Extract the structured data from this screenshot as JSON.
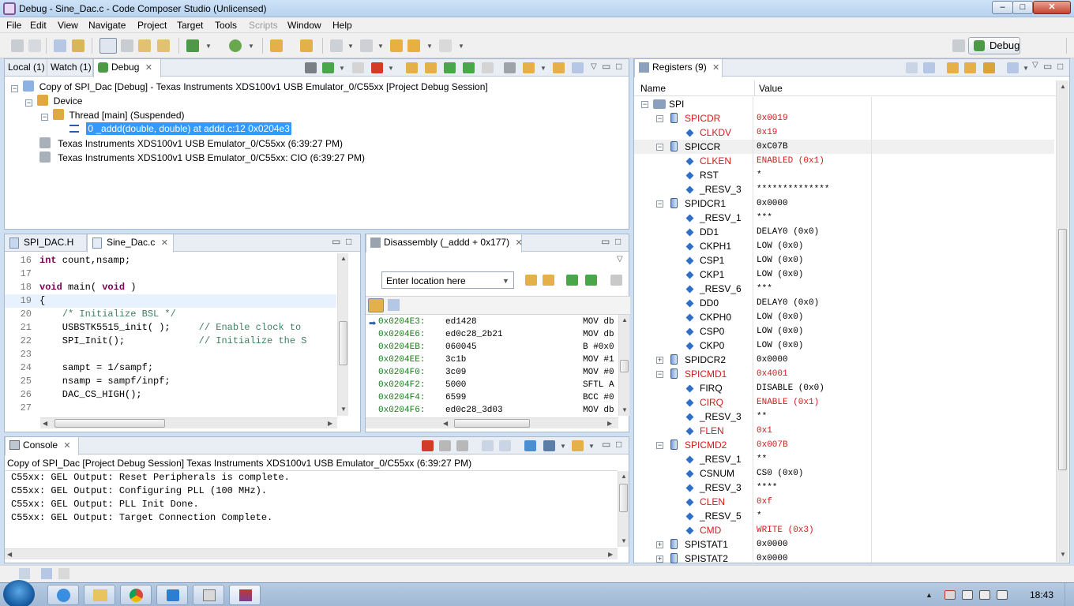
{
  "window": {
    "title": "Debug - Sine_Dac.c - Code Composer Studio (Unlicensed)",
    "min": "–",
    "max": "□",
    "close": "✕"
  },
  "menu": [
    "File",
    "Edit",
    "View",
    "Navigate",
    "Project",
    "Target",
    "Tools",
    "Scripts",
    "Window",
    "Help"
  ],
  "perspective": {
    "label": "Debug"
  },
  "debug_view": {
    "tabs": [
      "Local (1)",
      "Watch (1)",
      "Debug"
    ],
    "tree": [
      "Copy of SPI_Dac [Debug] - Texas Instruments XDS100v1 USB Emulator_0/C55xx [Project Debug Session]",
      "Device",
      "Thread [main] (Suspended)",
      "0 _addd(double, double) at addd.c:12 0x0204e3",
      "Texas Instruments XDS100v1 USB Emulator_0/C55xx (6:39:27 PM)",
      "Texas Instruments XDS100v1 USB Emulator_0/C55xx: CIO (6:39:27 PM)"
    ]
  },
  "editor": {
    "tabs": [
      "SPI_DAC.H",
      "Sine_Dac.c"
    ],
    "lines": [
      {
        "n": "16",
        "code": "int count,nsamp;"
      },
      {
        "n": "17",
        "code": ""
      },
      {
        "n": "18",
        "code": "void main( void )"
      },
      {
        "n": "19",
        "code": "{"
      },
      {
        "n": "20",
        "code": "    /* Initialize BSL */"
      },
      {
        "n": "21",
        "code": "    USBSTK5515_init( );     // Enable clock to"
      },
      {
        "n": "22",
        "code": "    SPI_Init();             // Initialize the S"
      },
      {
        "n": "23",
        "code": ""
      },
      {
        "n": "24",
        "code": "    sampt = 1/sampf;"
      },
      {
        "n": "25",
        "code": "    nsamp = sampf/inpf;"
      },
      {
        "n": "26",
        "code": "    DAC_CS_HIGH();"
      },
      {
        "n": "27",
        "code": ""
      }
    ]
  },
  "disassembly": {
    "tab": "Disassembly (_addd + 0x177)",
    "location_placeholder": "Enter location here",
    "rows": [
      {
        "addr": "0x0204E3:",
        "hex": "ed1428",
        "ins": "MOV db"
      },
      {
        "addr": "0x0204E6:",
        "hex": "ed0c28_2b21",
        "ins": "MOV db"
      },
      {
        "addr": "0x0204EB:",
        "hex": "060045",
        "ins": "B #0x0"
      },
      {
        "addr": "0x0204EE:",
        "hex": "3c1b",
        "ins": "MOV #1"
      },
      {
        "addr": "0x0204F0:",
        "hex": "3c09",
        "ins": "MOV #0"
      },
      {
        "addr": "0x0204F2:",
        "hex": "5000",
        "ins": "SFTL A"
      },
      {
        "addr": "0x0204F4:",
        "hex": "6599",
        "ins": "BCC #0"
      },
      {
        "addr": "0x0204F6:",
        "hex": "ed0c28_3d03",
        "ins": "MOV db"
      }
    ]
  },
  "console": {
    "tab": "Console",
    "header": "Copy of SPI_Dac [Project Debug Session] Texas Instruments XDS100v1 USB Emulator_0/C55xx (6:39:27 PM)",
    "lines": [
      "C55xx: GEL Output: Reset Peripherals is complete.",
      "C55xx: GEL Output: Configuring PLL (100 MHz).",
      "C55xx: GEL Output: PLL Init Done.",
      "C55xx: GEL Output: Target Connection Complete."
    ]
  },
  "registers": {
    "tab": "Registers (9)",
    "col_name": "Name",
    "col_value": "Value",
    "rows": [
      {
        "level": 0,
        "kind": "group",
        "name": "SPI",
        "value": "",
        "red": false,
        "exp": "−"
      },
      {
        "level": 1,
        "kind": "reg",
        "name": "SPICDR",
        "value": "0x0019",
        "red": true,
        "exp": "−"
      },
      {
        "level": 2,
        "kind": "field",
        "name": "CLKDV",
        "value": "0x19",
        "red": true
      },
      {
        "level": 1,
        "kind": "reg",
        "name": "SPICCR",
        "value": "0xC07B",
        "red": false,
        "exp": "−"
      },
      {
        "level": 2,
        "kind": "field",
        "name": "CLKEN",
        "value": "ENABLED (0x1)",
        "red": true
      },
      {
        "level": 2,
        "kind": "field",
        "name": "RST",
        "value": "*",
        "red": false
      },
      {
        "level": 2,
        "kind": "field",
        "name": "_RESV_3",
        "value": "**************",
        "red": false
      },
      {
        "level": 1,
        "kind": "reg",
        "name": "SPIDCR1",
        "value": "0x0000",
        "red": false,
        "exp": "−"
      },
      {
        "level": 2,
        "kind": "field",
        "name": "_RESV_1",
        "value": "***",
        "red": false
      },
      {
        "level": 2,
        "kind": "field",
        "name": "DD1",
        "value": "DELAY0 (0x0)",
        "red": false
      },
      {
        "level": 2,
        "kind": "field",
        "name": "CKPH1",
        "value": "LOW (0x0)",
        "red": false
      },
      {
        "level": 2,
        "kind": "field",
        "name": "CSP1",
        "value": "LOW (0x0)",
        "red": false
      },
      {
        "level": 2,
        "kind": "field",
        "name": "CKP1",
        "value": "LOW (0x0)",
        "red": false
      },
      {
        "level": 2,
        "kind": "field",
        "name": "_RESV_6",
        "value": "***",
        "red": false
      },
      {
        "level": 2,
        "kind": "field",
        "name": "DD0",
        "value": "DELAY0 (0x0)",
        "red": false
      },
      {
        "level": 2,
        "kind": "field",
        "name": "CKPH0",
        "value": "LOW (0x0)",
        "red": false
      },
      {
        "level": 2,
        "kind": "field",
        "name": "CSP0",
        "value": "LOW (0x0)",
        "red": false
      },
      {
        "level": 2,
        "kind": "field",
        "name": "CKP0",
        "value": "LOW (0x0)",
        "red": false
      },
      {
        "level": 1,
        "kind": "reg",
        "name": "SPIDCR2",
        "value": "0x0000",
        "red": false,
        "exp": "+"
      },
      {
        "level": 1,
        "kind": "reg",
        "name": "SPICMD1",
        "value": "0x4001",
        "red": true,
        "exp": "−"
      },
      {
        "level": 2,
        "kind": "field",
        "name": "FIRQ",
        "value": "DISABLE (0x0)",
        "red": false
      },
      {
        "level": 2,
        "kind": "field",
        "name": "CIRQ",
        "value": "ENABLE (0x1)",
        "red": true
      },
      {
        "level": 2,
        "kind": "field",
        "name": "_RESV_3",
        "value": "**",
        "red": false
      },
      {
        "level": 2,
        "kind": "field",
        "name": "FLEN",
        "value": "0x1",
        "red": true
      },
      {
        "level": 1,
        "kind": "reg",
        "name": "SPICMD2",
        "value": "0x007B",
        "red": true,
        "exp": "−"
      },
      {
        "level": 2,
        "kind": "field",
        "name": "_RESV_1",
        "value": "**",
        "red": false
      },
      {
        "level": 2,
        "kind": "field",
        "name": "CSNUM",
        "value": "CS0 (0x0)",
        "red": false
      },
      {
        "level": 2,
        "kind": "field",
        "name": "_RESV_3",
        "value": "****",
        "red": false
      },
      {
        "level": 2,
        "kind": "field",
        "name": "CLEN",
        "value": "0xf",
        "red": true
      },
      {
        "level": 2,
        "kind": "field",
        "name": "_RESV_5",
        "value": "*",
        "red": false
      },
      {
        "level": 2,
        "kind": "field",
        "name": "CMD",
        "value": "WRITE (0x3)",
        "red": true
      },
      {
        "level": 1,
        "kind": "reg",
        "name": "SPISTAT1",
        "value": "0x0000",
        "red": false,
        "exp": "+"
      },
      {
        "level": 1,
        "kind": "reg",
        "name": "SPISTAT2",
        "value": "0x0000",
        "red": false,
        "exp": "+"
      }
    ]
  },
  "taskbar": {
    "clock": "18:43"
  },
  "colors": {
    "selection": "#3399ff",
    "changed_value": "#d21b1b",
    "keyword": "#7f0055",
    "comment": "#3f7f5f"
  }
}
